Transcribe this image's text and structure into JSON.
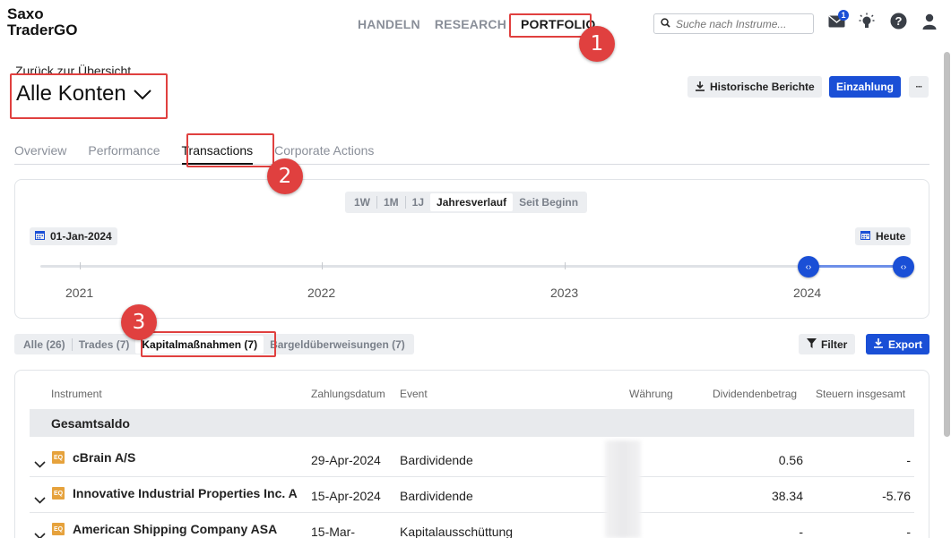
{
  "app": {
    "logo_line1": "Saxo",
    "logo_line2": "TraderGO"
  },
  "topnav": {
    "items": [
      "HANDELN",
      "RESEARCH",
      "PORTFOLIO"
    ],
    "active": "PORTFOLIO"
  },
  "search": {
    "placeholder": "Suche nach Instrume..."
  },
  "header_icons": {
    "notifications_count": "1"
  },
  "account": {
    "back_link": "Zurück zur Übersicht",
    "title": "Alle Konten"
  },
  "actions": {
    "history_reports": "Historische Berichte",
    "deposit": "Einzahlung",
    "more": "···"
  },
  "tabs": [
    "Overview",
    "Performance",
    "Transactions",
    "Corporate Actions"
  ],
  "period": {
    "options": [
      "1W",
      "1M",
      "1J",
      "Jahresverlauf",
      "Seit Beginn"
    ],
    "active": "Jahresverlauf"
  },
  "timeline": {
    "start_date": "01-Jan-2024",
    "end_date": "Heute",
    "years": [
      "2021",
      "2022",
      "2023",
      "2024"
    ]
  },
  "filters": {
    "options": [
      "Alle (26)",
      "Trades (7)",
      "Kapitalmaßnahmen (7)",
      "Bargeldüberweisungen (7)"
    ],
    "active": "Kapitalmaßnahmen (7)",
    "filter_label": "Filter",
    "export_label": "Export"
  },
  "table": {
    "columns": [
      "Instrument",
      "Zahlungsdatum",
      "Event",
      "Währung",
      "Dividendenbetrag",
      "Steuern insgesamt"
    ],
    "subtotal_label": "Gesamtsaldo",
    "rows": [
      {
        "type": "EQ",
        "instrument": "cBrain A/S",
        "date": "29-Apr-2024",
        "event": "Bardividende",
        "amount": "0.56",
        "tax": "-"
      },
      {
        "type": "EQ",
        "instrument": "Innovative Industrial Properties Inc. A",
        "date": "15-Apr-2024",
        "event": "Bardividende",
        "amount": "38.34",
        "tax": "-5.76"
      },
      {
        "type": "EQ",
        "instrument": "American Shipping Company ASA",
        "date": "15-Mar-",
        "event": "Kapitalausschüttung",
        "amount": "-",
        "tax": "-"
      }
    ]
  },
  "annotations": [
    "1",
    "2",
    "3"
  ],
  "colors": {
    "accent": "#1a4fd6",
    "highlight": "#e0403f",
    "equity_badge": "#e6a23c"
  }
}
